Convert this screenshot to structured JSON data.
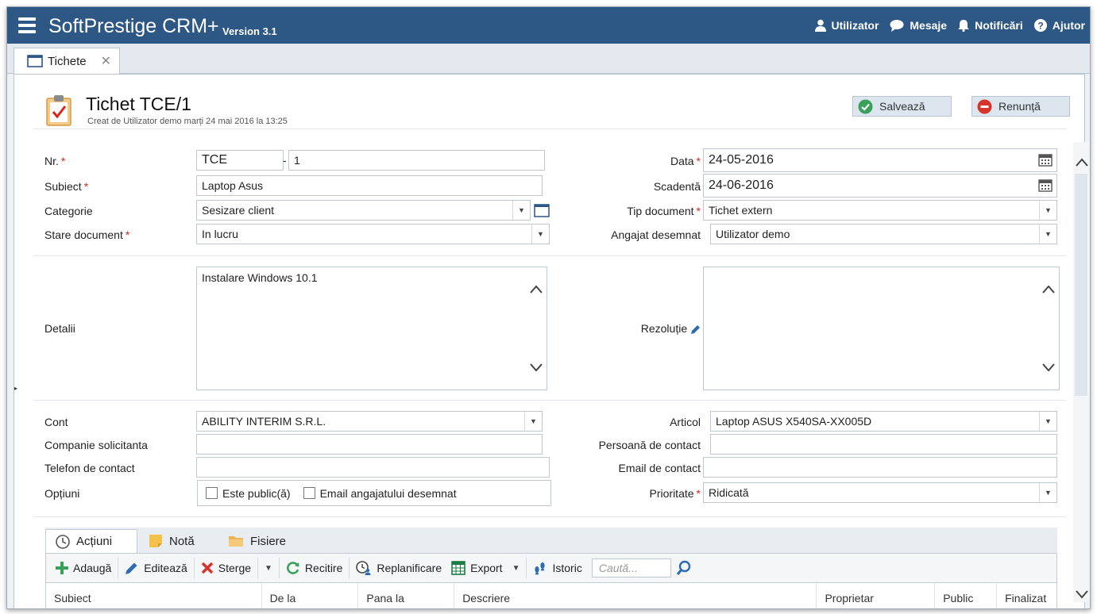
{
  "app": {
    "title": "SoftPrestige CRM+",
    "version": "Version 3.1",
    "nav": {
      "user": "Utilizator",
      "messages": "Mesaje",
      "notifications": "Notificări",
      "help": "Ajutor"
    }
  },
  "doc_tab": {
    "label": "Tichete",
    "close": "✕"
  },
  "header": {
    "title": "Tichet TCE/1",
    "subtitle": "Creat de Utilizator demo marți 24 mai 2016 la 13:25",
    "save_label": "Salvează",
    "cancel_label": "Renunță"
  },
  "form": {
    "nr": {
      "label": "Nr.",
      "prefix": "TCE",
      "separator": "-",
      "number": "1"
    },
    "subiect": {
      "label": "Subiect",
      "value": "Laptop Asus"
    },
    "categorie": {
      "label": "Categorie",
      "value": "Sesizare client"
    },
    "stare": {
      "label": "Stare document",
      "value": "In lucru"
    },
    "data": {
      "label": "Data",
      "value": "24-05-2016"
    },
    "scadenta": {
      "label": "Scadentă",
      "value": "24-06-2016"
    },
    "tip_document": {
      "label": "Tip document",
      "value": "Tichet extern"
    },
    "angajat": {
      "label": "Angajat desemnat",
      "value": "Utilizator demo"
    },
    "detalii": {
      "label": "Detalii",
      "value": "Instalare Windows 10.1"
    },
    "rezolutie": {
      "label": "Rezoluție",
      "value": ""
    },
    "cont": {
      "label": "Cont",
      "value": "ABILITY INTERIM S.R.L."
    },
    "companie": {
      "label": "Companie solicitanta",
      "value": ""
    },
    "telefon": {
      "label": "Telefon de contact",
      "value": ""
    },
    "optiuni": {
      "label": "Opțiuni",
      "public": "Este public(ă)",
      "email_angajat": "Email angajatului desemnat"
    },
    "articol": {
      "label": "Articol",
      "value": "Laptop ASUS X540SA-XX005D"
    },
    "persoana": {
      "label": "Persoană de contact",
      "value": ""
    },
    "email": {
      "label": "Email de contact",
      "value": ""
    },
    "prioritate": {
      "label": "Prioritate",
      "value": "Ridicată"
    },
    "required_mark": "*"
  },
  "bottom_tabs": [
    "Acțiuni",
    "Notă",
    "Fisiere"
  ],
  "toolbar": {
    "add": "Adaugă",
    "edit": "Editează",
    "delete": "Sterge",
    "reload": "Recitire",
    "reschedule": "Replanificare",
    "export": "Export",
    "history": "Istoric",
    "search_placeholder": "Caută..."
  },
  "grid_columns": [
    "Subiect",
    "De la",
    "Pana la",
    "Descriere",
    "Proprietar",
    "Public",
    "Finalizat"
  ],
  "colors": {
    "topbar": "#2d5785",
    "required": "#d9261c",
    "save": "#3aa15b",
    "cancel": "#d7352b"
  }
}
